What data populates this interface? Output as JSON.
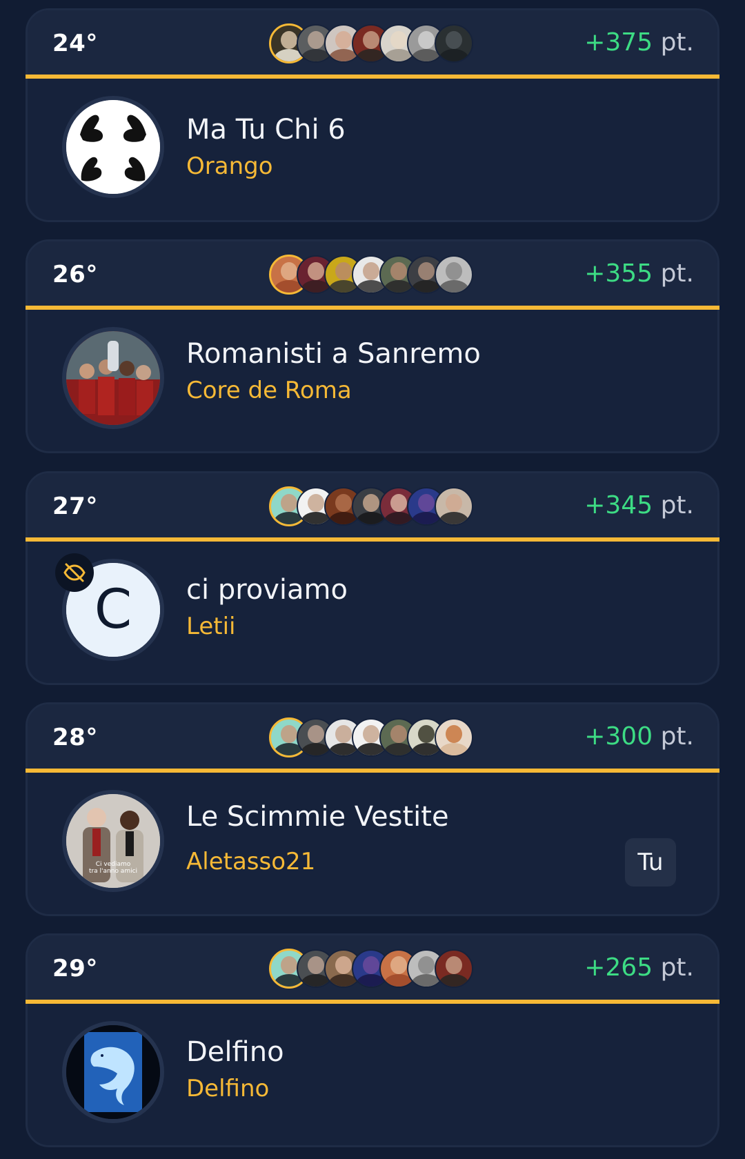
{
  "entries": [
    {
      "rank": "24°",
      "points_value": "+375",
      "points_unit": "pt.",
      "team_name": "Ma Tu Chi 6",
      "owner": "Orango",
      "avatar_kind": "hands-logo",
      "is_you": false,
      "is_hidden": false
    },
    {
      "rank": "26°",
      "points_value": "+355",
      "points_unit": "pt.",
      "team_name": "Romanisti a Sanremo",
      "owner": "Core de Roma",
      "avatar_kind": "team-photo",
      "is_you": false,
      "is_hidden": false
    },
    {
      "rank": "27°",
      "points_value": "+345",
      "points_unit": "pt.",
      "team_name": "ci proviamo",
      "owner": "Letii",
      "avatar_kind": "letter",
      "avatar_letter": "C",
      "is_you": false,
      "is_hidden": true,
      "hidden_icon": "eye-off-icon"
    },
    {
      "rank": "28°",
      "points_value": "+300",
      "points_unit": "pt.",
      "team_name": "Le Scimmie Vestite",
      "owner": "Aletasso21",
      "avatar_kind": "meme-photo",
      "avatar_caption": "Ci vediamo tra l'anno amici",
      "is_you": true,
      "you_label": "Tu",
      "is_hidden": false
    },
    {
      "rank": "29°",
      "points_value": "+265",
      "points_unit": "pt.",
      "team_name": "Delfino",
      "owner": "Delfino",
      "avatar_kind": "dolphin-art",
      "is_you": false,
      "is_hidden": false
    }
  ],
  "colors": {
    "background": "#111c33",
    "card": "#16223b",
    "accent": "#f6b936",
    "points": "#3ddc84",
    "text": "#f2f4f8"
  }
}
